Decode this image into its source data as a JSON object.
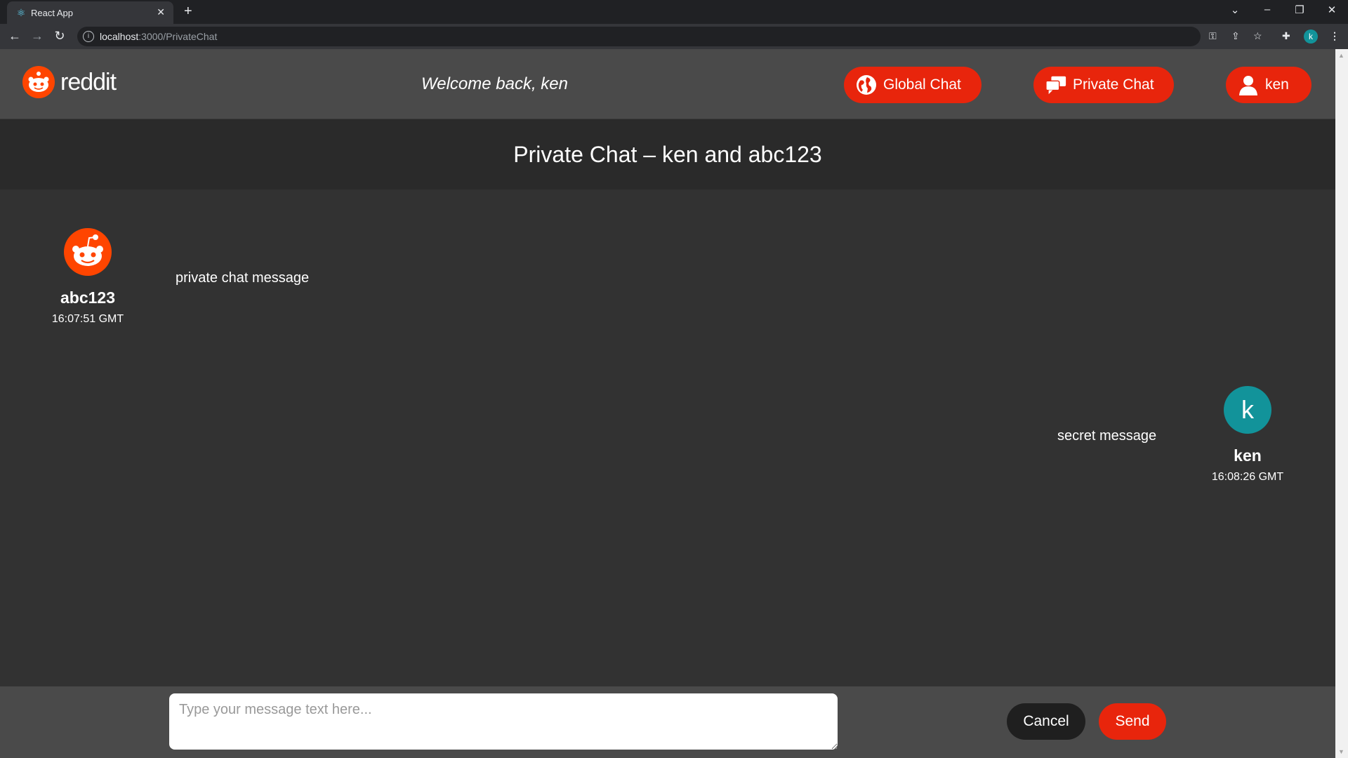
{
  "browser": {
    "tab_title": "React App",
    "tab_close": "✕",
    "new_tab": "+",
    "url_host": "localhost",
    "url_path": ":3000/PrivateChat",
    "profile_initial": "k",
    "window_controls": [
      "⌄",
      "–",
      "❐",
      "✕"
    ]
  },
  "header": {
    "logo_text": "reddit",
    "welcome": "Welcome back, ken",
    "nav": {
      "global_chat": "Global Chat",
      "private_chat": "Private Chat",
      "profile": "ken"
    }
  },
  "chat": {
    "title": "Private Chat – ken and abc123",
    "messages": [
      {
        "user": "abc123",
        "time": "16:07:51 GMT",
        "text": "private chat message",
        "avatar": "reddit-snoo-icon"
      },
      {
        "user": "ken",
        "time": "16:08:26 GMT",
        "text": "secret message",
        "avatar_initial": "k"
      }
    ]
  },
  "composer": {
    "placeholder": "Type your message text here...",
    "cancel": "Cancel",
    "send": "Send"
  },
  "colors": {
    "accent": "#e8250c",
    "reddit_orange": "#ff4500",
    "avatar_teal": "#12939a",
    "background": "#323232"
  }
}
